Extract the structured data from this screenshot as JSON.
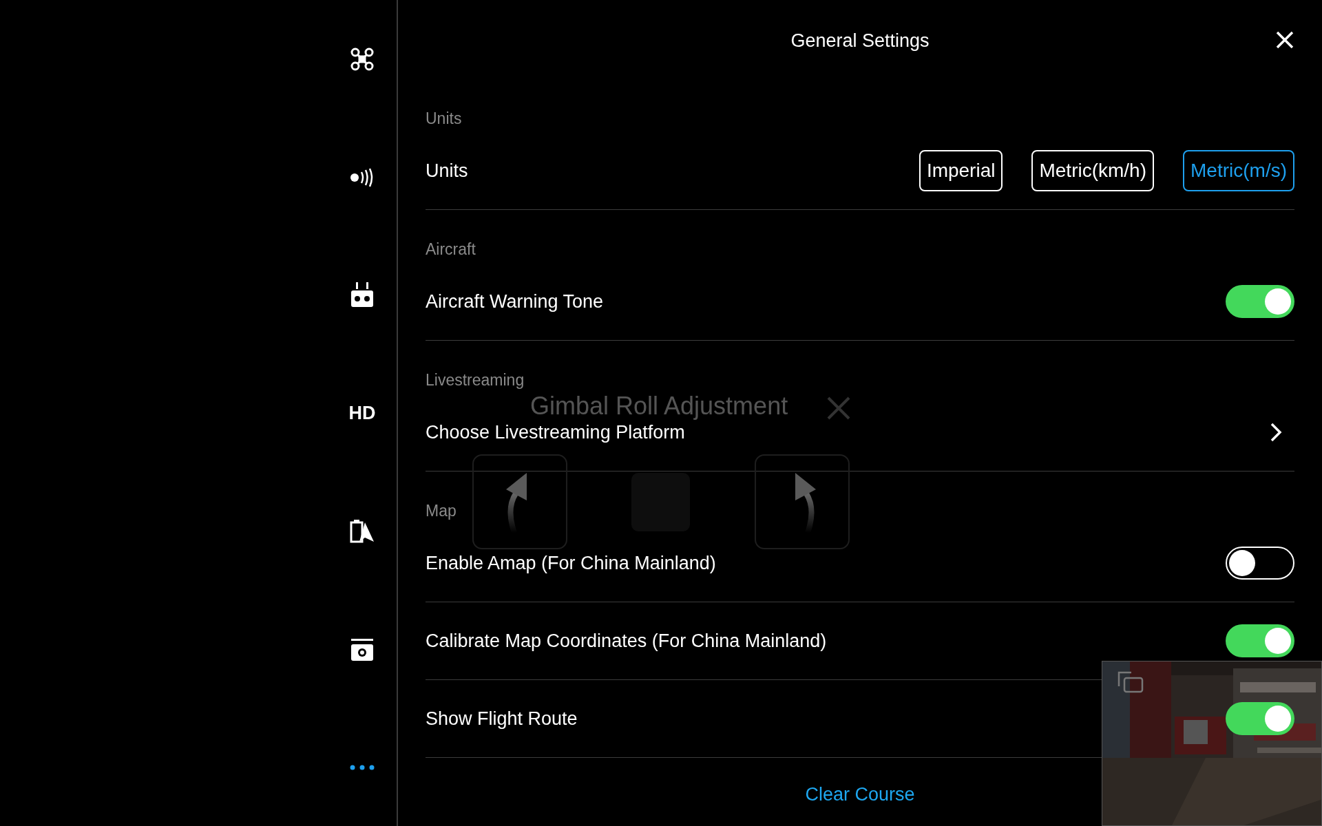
{
  "sidebar": {
    "items": [
      {
        "kind": "drone",
        "selected": false
      },
      {
        "kind": "signal",
        "selected": false
      },
      {
        "kind": "remote",
        "selected": false
      },
      {
        "kind": "text",
        "label": "HD",
        "selected": false
      },
      {
        "kind": "battery-nav",
        "selected": false
      },
      {
        "kind": "camera",
        "selected": false
      },
      {
        "kind": "more",
        "selected": true
      }
    ]
  },
  "header": {
    "title": "General Settings"
  },
  "sections": [
    {
      "label": "Units",
      "rows": [
        {
          "kind": "options",
          "label": "Units",
          "options": [
            {
              "label": "Imperial",
              "selected": false
            },
            {
              "label": "Metric(km/h)",
              "selected": false
            },
            {
              "label": "Metric(m/s)",
              "selected": true
            }
          ]
        }
      ]
    },
    {
      "label": "Aircraft",
      "rows": [
        {
          "kind": "toggle",
          "label": "Aircraft Warning Tone",
          "on": true
        }
      ]
    },
    {
      "label": "Livestreaming",
      "rows": [
        {
          "kind": "link",
          "label": "Choose Livestreaming Platform"
        }
      ]
    },
    {
      "label": "Map",
      "rows": [
        {
          "kind": "toggle",
          "label": "Enable Amap (For China Mainland)",
          "on": false
        },
        {
          "kind": "toggle",
          "label": "Calibrate Map Coordinates (For China Mainland)",
          "on": true
        },
        {
          "kind": "toggle",
          "label": "Show Flight Route",
          "on": true
        }
      ]
    }
  ],
  "footer_link": "Clear Course",
  "gimbal_overlay": {
    "title": "Gimbal Roll Adjustment"
  }
}
